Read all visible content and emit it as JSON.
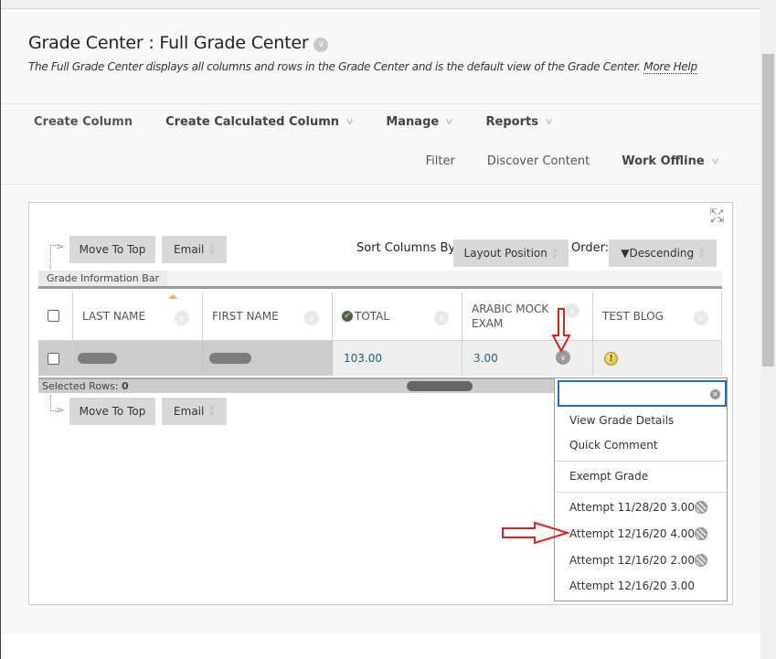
{
  "page": {
    "title": "Grade Center : Full Grade Center",
    "description": "The Full Grade Center displays all columns and rows in the Grade Center and is the default view of the Grade Center.",
    "more_help": "More Help"
  },
  "toolbar": {
    "primary": [
      {
        "label": "Create Column",
        "has_menu": false
      },
      {
        "label": "Create Calculated Column",
        "has_menu": true
      },
      {
        "label": "Manage",
        "has_menu": true
      },
      {
        "label": "Reports",
        "has_menu": true
      }
    ],
    "secondary": [
      {
        "label": "Filter",
        "has_menu": false
      },
      {
        "label": "Discover Content",
        "has_menu": false
      },
      {
        "label": "Work Offline",
        "has_menu": true
      }
    ]
  },
  "grid": {
    "actions": {
      "move_to_top": "Move To Top",
      "email": "Email"
    },
    "sort": {
      "label": "Sort Columns By:",
      "value": "Layout Position",
      "order_label": "Order:",
      "order_value": "▼Descending"
    },
    "info_bar_label": "Grade Information Bar",
    "columns": [
      {
        "key": "last_name",
        "label": "LAST NAME",
        "sorted": "ascending"
      },
      {
        "key": "first_name",
        "label": "FIRST NAME"
      },
      {
        "key": "total",
        "label": "TOTAL",
        "icon": "check-icon"
      },
      {
        "key": "arabic_mock_exam",
        "label": "ARABIC MOCK EXAM"
      },
      {
        "key": "test_blog",
        "label": "TEST BLOG"
      }
    ],
    "rows": [
      {
        "last_name": "[redacted]",
        "first_name": "[redacted]",
        "total": "103.00",
        "arabic_mock_exam": "3.00",
        "test_blog_status": "needs-grading-icon"
      }
    ],
    "selected_rows_label": "Selected Rows:",
    "selected_rows_count": "0"
  },
  "cell_menu": {
    "search_value": "",
    "items": [
      {
        "label": "View Grade Details"
      },
      {
        "label": "Quick Comment"
      },
      {
        "label": "Exempt Grade"
      },
      {
        "label": "Attempt 11/28/20 3.00",
        "icon": "in-progress-icon"
      },
      {
        "label": "Attempt 12/16/20 4.00",
        "icon": "in-progress-icon",
        "highlighted_by_arrow": true
      },
      {
        "label": "Attempt 12/16/20 2.00",
        "icon": "in-progress-icon"
      },
      {
        "label": "Attempt 12/16/20 3.00"
      }
    ]
  },
  "annotations": {
    "arrow_color": "#e02020"
  }
}
